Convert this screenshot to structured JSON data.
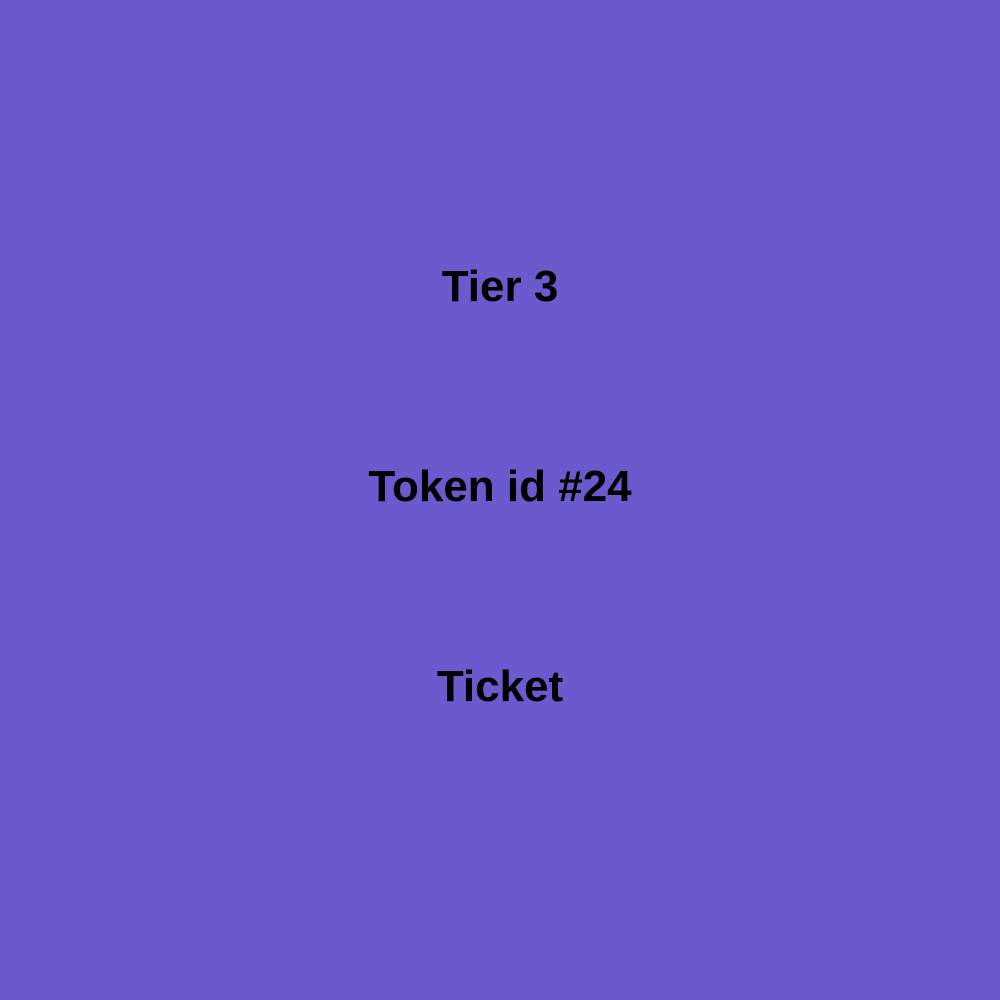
{
  "colors": {
    "background": "#6B5ACD",
    "text": "#000000"
  },
  "ticket": {
    "tier": "Tier 3",
    "token_id": "Token id #24",
    "label": "Ticket"
  }
}
